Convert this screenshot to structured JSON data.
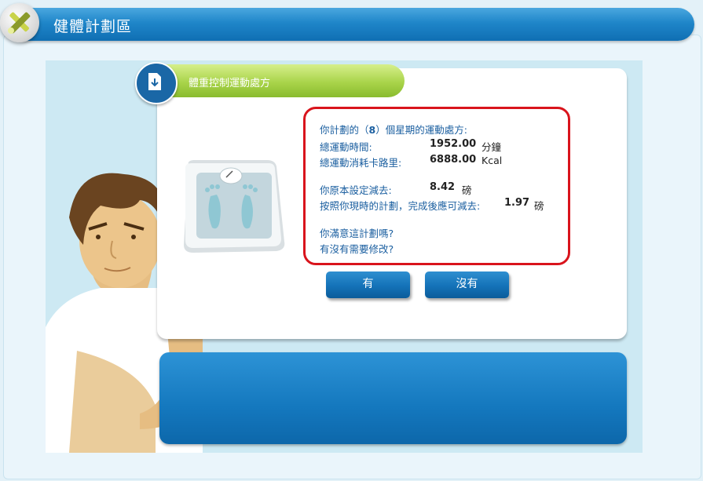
{
  "header": {
    "title": "健體計劃區",
    "icon": "tools-logo-icon"
  },
  "tab": {
    "title": "體重控制運動處方",
    "icon": "download-document-icon"
  },
  "plan": {
    "intro_prefix": "你計劃的（",
    "weeks": "8",
    "intro_suffix": "）個星期的運動處方:",
    "total_time_label": "總運動時間:",
    "total_time_value": "1952.00",
    "total_time_unit": "分鐘",
    "total_kcal_label": "總運動消耗卡路里:",
    "total_kcal_value": "6888.00",
    "total_kcal_unit": "Kcal",
    "target_label": "你原本設定減去:",
    "target_value": "8.42",
    "target_unit": "磅",
    "expected_label": "按照你現時的計劃，完成後應可減去:",
    "expected_value": "1.97",
    "expected_unit": "磅",
    "question1": "你滿意這計劃嗎?",
    "question2": "有沒有需要修改?"
  },
  "buttons": {
    "yes": "有",
    "no": "沒有"
  },
  "colors": {
    "header_blue": "#1f86c9",
    "tab_green": "#a9d44a",
    "highlight_red": "#d9141c",
    "text_blue": "#1b5fa0"
  }
}
